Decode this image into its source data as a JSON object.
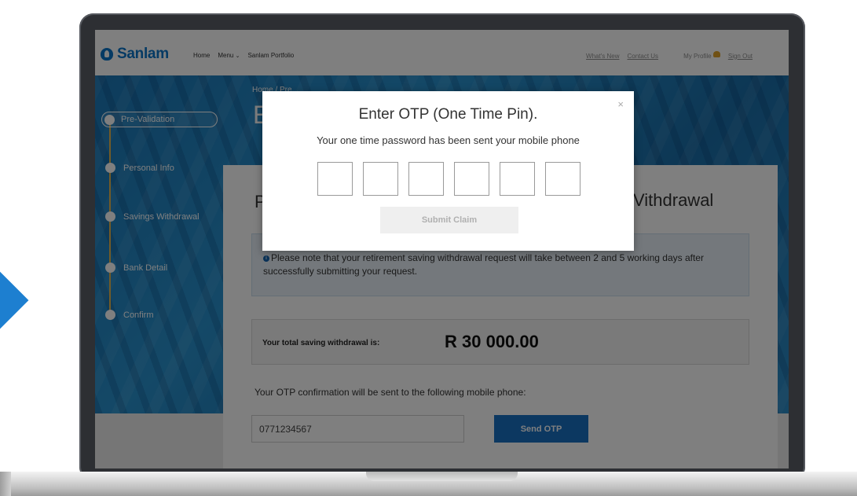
{
  "header": {
    "brand": "Sanlam",
    "nav_left": {
      "home": "Home",
      "menu": "Menu",
      "portfolio": "Sanlam Portfolio"
    },
    "nav_right": {
      "whats_new": "What's New",
      "contact_us": "Contact Us",
      "my_profile": "My Profile",
      "sign_out": "Sign Out"
    }
  },
  "page": {
    "breadcrumb": "Home / Pre...",
    "heading_fragment": "E"
  },
  "steps": [
    {
      "label": "Pre-Validation",
      "active": true
    },
    {
      "label": "Personal Info",
      "active": false
    },
    {
      "label": "Savings Withdrawal",
      "active": false
    },
    {
      "label": "Bank Detail",
      "active": false
    },
    {
      "label": "Confirm",
      "active": false
    }
  ],
  "card": {
    "title_left": "P",
    "title_right": "Vithdrawal",
    "notice": "Please note that your retirement saving withdrawal request will take between 2 and 5 working days after successfully submitting your request.",
    "total_label": "Your total saving withdrawal is:",
    "total_value": "R 30 000.00",
    "otp_note": "Your OTP confirmation will be sent to the following mobile phone:",
    "phone_value": "0771234567",
    "send_otp": "Send OTP"
  },
  "modal": {
    "title": "Enter OTP (One Time Pin).",
    "subtitle": "Your one time password has been sent your mobile phone",
    "close": "×",
    "otp_digits": [
      "",
      "",
      "",
      "",
      "",
      ""
    ],
    "submit": "Submit Claim"
  },
  "colors": {
    "brand_blue": "#0a74c8",
    "button_blue": "#1970c2",
    "step_line": "#e7b64e",
    "notice_bg": "#e8f1f8"
  },
  "icons": {
    "logo": "sanlam-logo-icon",
    "info": "info-icon",
    "profile": "profile-icon",
    "menu_dropdown": "chevron-down-icon",
    "close": "close-icon"
  }
}
